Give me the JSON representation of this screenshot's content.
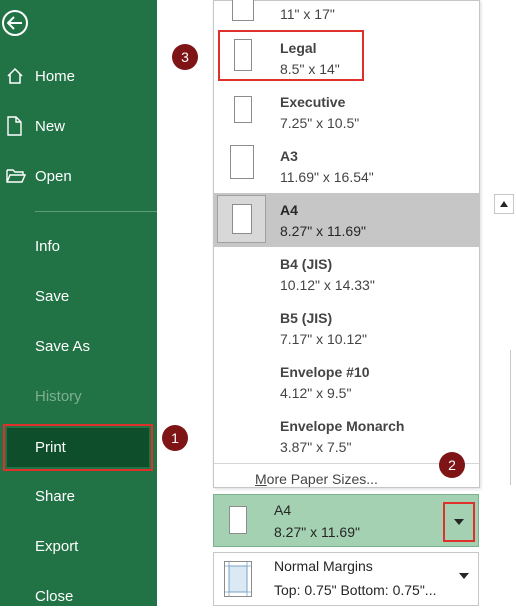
{
  "sidebar": {
    "home": "Home",
    "new": "New",
    "open": "Open",
    "info": "Info",
    "save": "Save",
    "save_as": "Save As",
    "history": "History",
    "print": "Print",
    "share": "Share",
    "export": "Export",
    "close": "Close"
  },
  "paper_sizes": {
    "partial_top_dim": "11\" x 17\"",
    "options": [
      {
        "name": "Legal",
        "dim": "8.5\" x 14\""
      },
      {
        "name": "Executive",
        "dim": "7.25\" x 10.5\""
      },
      {
        "name": "A3",
        "dim": "11.69\" x 16.54\""
      },
      {
        "name": "A4",
        "dim": "8.27\" x 11.69\""
      },
      {
        "name": "B4 (JIS)",
        "dim": "10.12\" x 14.33\""
      },
      {
        "name": "B5 (JIS)",
        "dim": "7.17\" x 10.12\""
      },
      {
        "name": "Envelope #10",
        "dim": "4.12\" x 9.5\""
      },
      {
        "name": "Envelope Monarch",
        "dim": "3.87\" x 7.5\""
      }
    ],
    "selected": "A4",
    "more_first_letter": "M",
    "more_rest": "ore Paper Sizes..."
  },
  "current_size": {
    "name": "A4",
    "dim": "8.27\" x 11.69\""
  },
  "margins": {
    "name": "Normal Margins",
    "detail": "Top: 0.75\" Bottom: 0.75\"..."
  },
  "badges": {
    "one": "1",
    "two": "2",
    "three": "3"
  },
  "colors": {
    "sidebar": "#217346",
    "print_selected": "#0e4e2b",
    "highlight": "#e0302b",
    "badge": "#7e1416"
  }
}
